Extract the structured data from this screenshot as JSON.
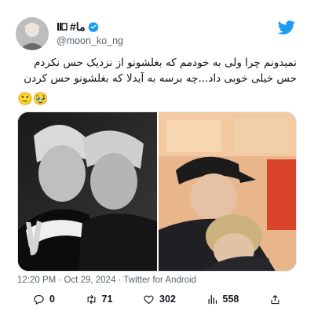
{
  "user": {
    "display_name": "#ما",
    "handle": "@moon_ko_ng",
    "verified": true
  },
  "tweet": {
    "text": "نمیدونم چرا ولی به خودمم که بغلشونو از نزدیک حس نکردم حس خیلی خوبی داد...چه برسه به آیدلا که بغلشونو حس کردن",
    "emojis": "🙂🥹"
  },
  "meta": {
    "time": "12:20 PM",
    "date": "Oct 29, 2024",
    "client": "Twitter for Android",
    "separator": "·"
  },
  "actions": {
    "replies": "0",
    "retweets": "71",
    "likes": "302",
    "views": "558"
  },
  "icons": {
    "bird": "twitter-bird-icon",
    "verified": "verified-badge-icon",
    "reply": "reply-icon",
    "retweet": "retweet-icon",
    "like": "heart-icon",
    "views": "views-icon",
    "share": "share-icon"
  },
  "colors": {
    "brand": "#1d9bf0",
    "secondary_text": "#536471",
    "primary_text": "#0f1419"
  }
}
